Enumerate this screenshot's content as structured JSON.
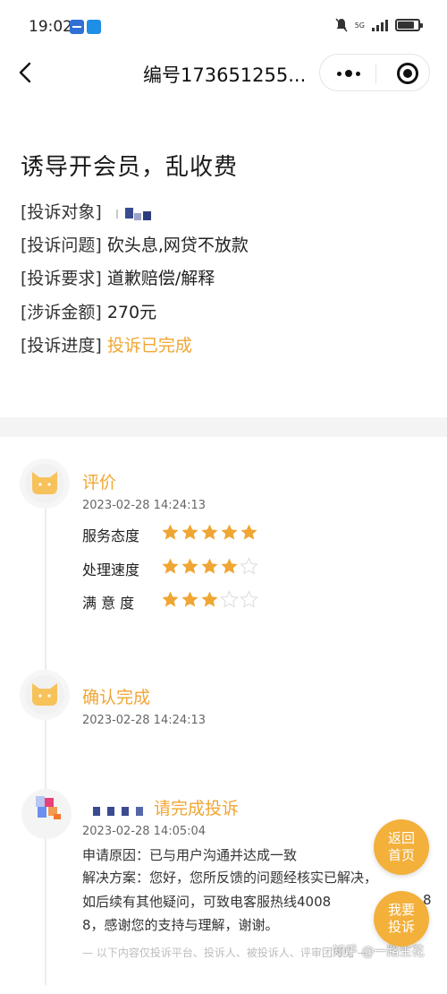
{
  "status_bar": {
    "time": "19:02",
    "network": "5G",
    "colors": {
      "app1": "#2f6fd6",
      "app2": "#1e8fe6"
    }
  },
  "nav": {
    "title": "编号173651255...",
    "back_icon": "chevron-left-icon",
    "more_icon": "more-dots-icon",
    "close_icon": "close-miniprogram-icon"
  },
  "complaint": {
    "title": "诱导开会员，乱收费",
    "fields": [
      {
        "label": "[投诉对象]",
        "value": ""
      },
      {
        "label": "[投诉问题]",
        "value": "砍头息,网贷不放款"
      },
      {
        "label": "[投诉要求]",
        "value": "道歉赔偿/解释"
      },
      {
        "label": "[涉诉金额]",
        "value": "270元"
      },
      {
        "label": "[投诉进度]",
        "value": "投诉已完成"
      }
    ]
  },
  "accent_color": "#f0a634",
  "timeline": {
    "evaluation": {
      "title": "评价",
      "time": "2023-02-28 14:24:13",
      "ratings": [
        {
          "label": "服务态度",
          "stars": 5,
          "max": 5
        },
        {
          "label": "处理速度",
          "stars": 4,
          "max": 5
        },
        {
          "label": "满 意 度",
          "stars": 3,
          "max": 5
        }
      ]
    },
    "confirm": {
      "title": "确认完成",
      "time": "2023-02-28 14:24:13"
    },
    "apply": {
      "title": "请完成投诉",
      "time": "2023-02-28 14:05:04",
      "reason": "申请原因：已与用户沟通并达成一致",
      "solution_line1": "解决方案：您好，您所反馈的问题经核实已解决，",
      "solution_line2": "如后续有其他疑问，可致电客服热线4008",
      "solution_line2_tail": "8",
      "solution_line3": "8，感谢您的支持与理解，谢谢。"
    }
  },
  "footer_note": "— 以下内容仅投诉平台、投诉人、被投诉人、评审团可见 —",
  "watermark": "知乎 @一路生花",
  "float_buttons": {
    "home": {
      "line1": "返回",
      "line2": "首页"
    },
    "complain": {
      "line1": "我要",
      "line2": "投诉"
    }
  }
}
